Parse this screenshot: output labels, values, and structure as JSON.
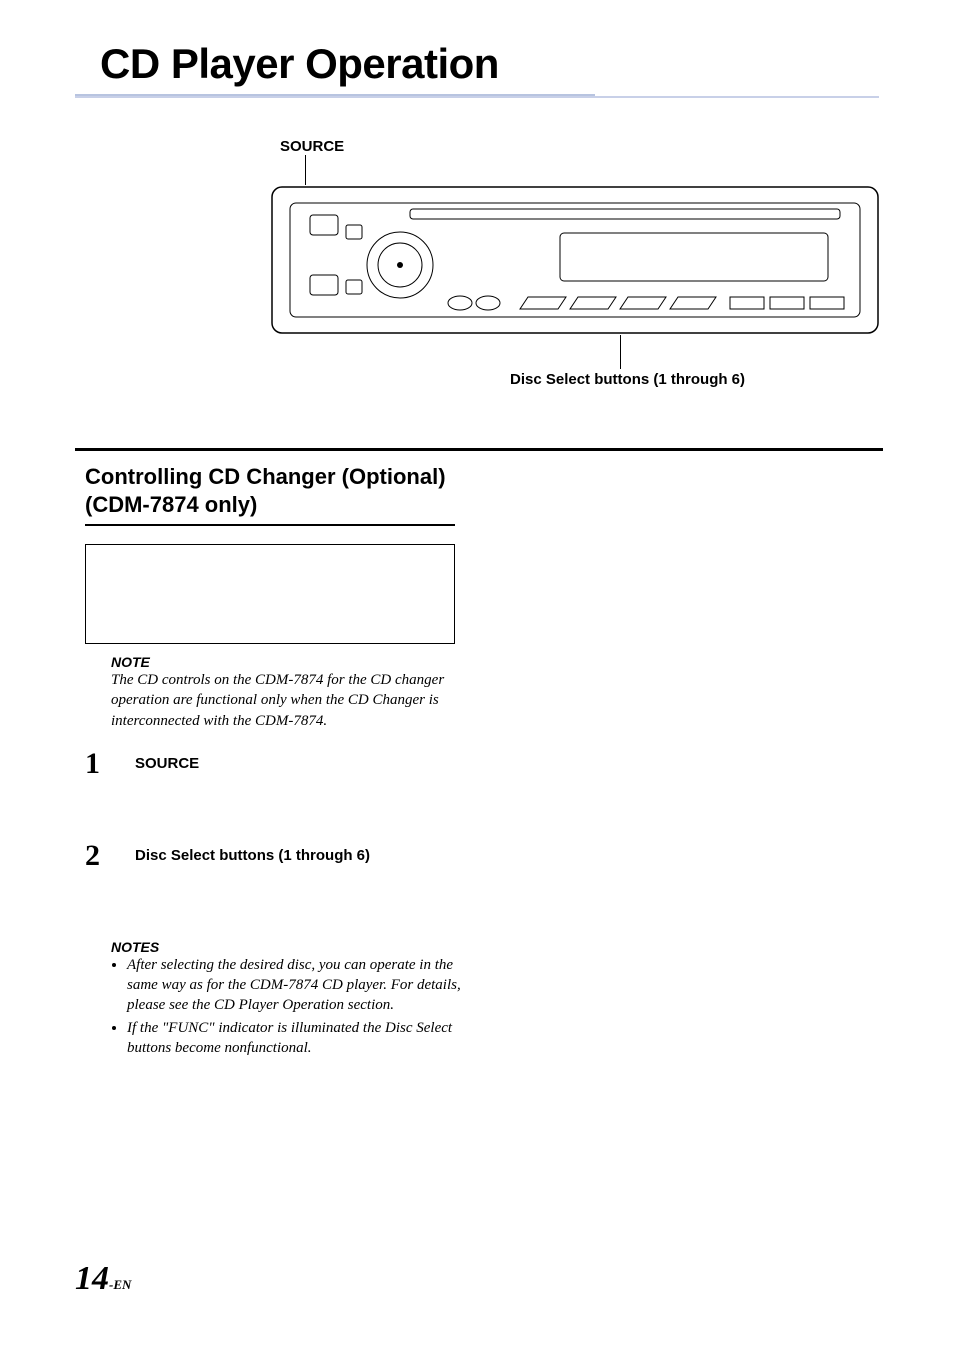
{
  "title": "CD Player Operation",
  "diagram": {
    "source_label": "SOURCE",
    "disc_select_label": "Disc Select buttons (1 through 6)"
  },
  "section": {
    "heading": "Controlling CD Changer (Optional) (CDM-7874 only)",
    "note_label": "NOTE",
    "note_text": "The CD controls on the CDM-7874 for the CD changer operation are functional only when the CD Changer is interconnected with the CDM-7874.",
    "steps": [
      {
        "num": "1",
        "bold": "SOURCE"
      },
      {
        "num": "2",
        "bold": "Disc Select buttons (1 through 6)"
      }
    ],
    "notes_label": "NOTES",
    "notes": [
      "After selecting the desired disc, you can operate in the same way as for the CDM-7874 CD player. For details, please see the CD Player Operation section.",
      "If the \"FUNC\" indicator is illuminated the Disc Select buttons become nonfunctional."
    ]
  },
  "page_number": "14",
  "page_suffix": "-EN"
}
